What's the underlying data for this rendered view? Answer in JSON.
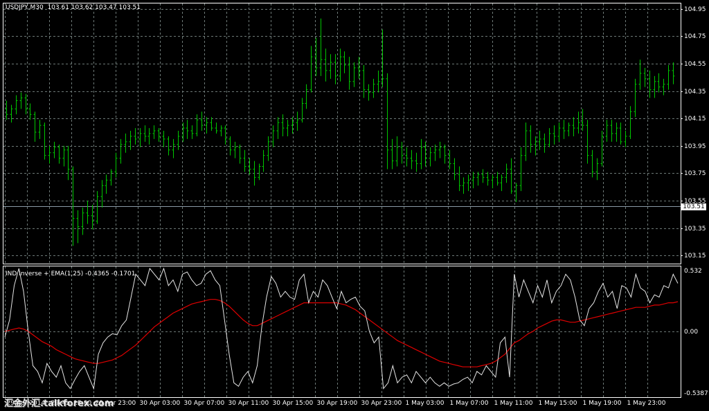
{
  "chart_data": [
    {
      "type": "bar",
      "subtype": "ohlc",
      "title": "USDJPY,M30",
      "ohlc_header": "103.61 103.62 103.47 103.51",
      "last_price": "103.51",
      "colors": {
        "background": "#000000",
        "bars": "#00c800",
        "grid": "#6e7a78",
        "axis": "#ffffff",
        "price_line": "#8a9aa6"
      },
      "ylim": [
        103.09,
        104.99
      ],
      "y_ticks": [
        "104.95",
        "104.75",
        "104.55",
        "104.35",
        "104.15",
        "103.95",
        "103.75",
        "103.55",
        "103.35",
        "103.15"
      ],
      "grid": true,
      "x_ticks": [
        "29 Apr 2014",
        "29 Apr 15:00",
        "29 Apr 23:00",
        "30 Apr 03:00",
        "30 Apr 07:00",
        "30 Apr 11:00",
        "30 Apr 15:00",
        "30 Apr 19:00",
        "30 Apr 23:00",
        "1 May 03:00",
        "1 May 07:00",
        "1 May 11:00",
        "1 May 15:00",
        "1 May 19:00",
        "1 May 23:00"
      ],
      "bars": [
        [
          104.22,
          104.28,
          104.14,
          104.18
        ],
        [
          104.18,
          104.25,
          104.12,
          104.22
        ],
        [
          104.22,
          104.32,
          104.18,
          104.28
        ],
        [
          104.28,
          104.34,
          104.22,
          104.3
        ],
        [
          104.3,
          104.33,
          104.18,
          104.22
        ],
        [
          104.22,
          104.26,
          104.14,
          104.18
        ],
        [
          104.18,
          104.2,
          103.98,
          104.05
        ],
        [
          104.05,
          104.14,
          104.0,
          104.1
        ],
        [
          104.1,
          104.12,
          103.85,
          103.88
        ],
        [
          103.88,
          103.95,
          103.82,
          103.9
        ],
        [
          103.9,
          103.98,
          103.86,
          103.94
        ],
        [
          103.94,
          103.96,
          103.82,
          103.86
        ],
        [
          103.86,
          103.95,
          103.8,
          103.92
        ],
        [
          103.92,
          103.95,
          103.7,
          103.78
        ],
        [
          103.78,
          103.8,
          103.22,
          103.42
        ],
        [
          103.42,
          103.48,
          103.24,
          103.36
        ],
        [
          103.36,
          103.5,
          103.3,
          103.46
        ],
        [
          103.46,
          103.55,
          103.38,
          103.44
        ],
        [
          103.44,
          103.52,
          103.34,
          103.4
        ],
        [
          103.4,
          103.62,
          103.38,
          103.58
        ],
        [
          103.58,
          103.7,
          103.5,
          103.66
        ],
        [
          103.66,
          103.74,
          103.6,
          103.7
        ],
        [
          103.7,
          103.78,
          103.66,
          103.76
        ],
        [
          103.76,
          103.9,
          103.72,
          103.86
        ],
        [
          103.86,
          104.0,
          103.82,
          103.96
        ],
        [
          103.96,
          104.04,
          103.9,
          103.98
        ],
        [
          103.98,
          104.06,
          103.92,
          104.02
        ],
        [
          104.02,
          104.08,
          103.96,
          104.0
        ],
        [
          104.0,
          104.08,
          103.94,
          104.04
        ],
        [
          104.04,
          104.1,
          103.98,
          104.02
        ],
        [
          104.02,
          104.08,
          103.96,
          104.04
        ],
        [
          104.04,
          104.1,
          104.0,
          104.06
        ],
        [
          104.06,
          104.08,
          103.98,
          104.02
        ],
        [
          104.02,
          104.06,
          103.94,
          104.0
        ],
        [
          104.0,
          104.02,
          103.88,
          103.92
        ],
        [
          103.92,
          104.0,
          103.86,
          103.96
        ],
        [
          103.96,
          104.06,
          103.92,
          104.02
        ],
        [
          104.02,
          104.12,
          103.98,
          104.08
        ],
        [
          104.08,
          104.14,
          104.0,
          104.06
        ],
        [
          104.06,
          104.1,
          104.0,
          104.04
        ],
        [
          104.04,
          104.18,
          104.02,
          104.14
        ],
        [
          104.14,
          104.2,
          104.06,
          104.1
        ],
        [
          104.1,
          104.16,
          104.04,
          104.12
        ],
        [
          104.12,
          104.16,
          104.06,
          104.08
        ],
        [
          104.08,
          104.12,
          104.04,
          104.06
        ],
        [
          104.06,
          104.1,
          104.02,
          104.08
        ],
        [
          104.08,
          104.1,
          103.96,
          104.0
        ],
        [
          104.0,
          104.02,
          103.88,
          103.92
        ],
        [
          103.92,
          103.98,
          103.86,
          103.94
        ],
        [
          103.94,
          103.96,
          103.82,
          103.86
        ],
        [
          103.86,
          103.92,
          103.76,
          103.8
        ],
        [
          103.8,
          103.86,
          103.74,
          103.78
        ],
        [
          103.78,
          103.84,
          103.66,
          103.72
        ],
        [
          103.72,
          103.82,
          103.7,
          103.8
        ],
        [
          103.8,
          103.92,
          103.76,
          103.88
        ],
        [
          103.88,
          104.02,
          103.84,
          103.98
        ],
        [
          103.98,
          104.1,
          103.94,
          104.06
        ],
        [
          104.06,
          104.16,
          104.0,
          104.12
        ],
        [
          104.12,
          104.18,
          104.02,
          104.08
        ],
        [
          104.08,
          104.14,
          104.02,
          104.1
        ],
        [
          104.1,
          104.16,
          104.04,
          104.12
        ],
        [
          104.12,
          104.2,
          104.06,
          104.14
        ],
        [
          104.14,
          104.3,
          104.12,
          104.26
        ],
        [
          104.26,
          104.4,
          104.22,
          104.36
        ],
        [
          104.36,
          104.68,
          104.34,
          104.6
        ],
        [
          104.6,
          104.74,
          104.46,
          104.52
        ],
        [
          104.52,
          104.88,
          104.46,
          104.58
        ],
        [
          104.58,
          104.66,
          104.42,
          104.5
        ],
        [
          104.5,
          104.62,
          104.44,
          104.56
        ],
        [
          104.56,
          104.62,
          104.4,
          104.46
        ],
        [
          104.46,
          104.66,
          104.42,
          104.6
        ],
        [
          104.6,
          104.64,
          104.48,
          104.54
        ],
        [
          104.54,
          104.6,
          104.36,
          104.42
        ],
        [
          104.42,
          104.56,
          104.38,
          104.52
        ],
        [
          104.52,
          104.6,
          104.44,
          104.5
        ],
        [
          104.5,
          104.54,
          104.3,
          104.36
        ],
        [
          104.36,
          104.4,
          104.28,
          104.34
        ],
        [
          104.34,
          104.44,
          104.3,
          104.4
        ],
        [
          104.4,
          104.5,
          104.34,
          104.42
        ],
        [
          104.42,
          104.8,
          104.38,
          104.44
        ],
        [
          104.44,
          104.48,
          103.78,
          103.92
        ],
        [
          103.92,
          104.0,
          103.78,
          103.84
        ],
        [
          103.84,
          104.02,
          103.8,
          103.94
        ],
        [
          103.94,
          103.98,
          103.82,
          103.88
        ],
        [
          103.88,
          103.94,
          103.8,
          103.86
        ],
        [
          103.86,
          103.92,
          103.78,
          103.84
        ],
        [
          103.84,
          103.9,
          103.76,
          103.82
        ],
        [
          103.82,
          104.0,
          103.78,
          103.94
        ],
        [
          103.94,
          103.98,
          103.8,
          103.86
        ],
        [
          103.86,
          103.94,
          103.8,
          103.9
        ],
        [
          103.9,
          103.96,
          103.84,
          103.92
        ],
        [
          103.92,
          103.98,
          103.86,
          103.94
        ],
        [
          103.94,
          103.96,
          103.82,
          103.88
        ],
        [
          103.88,
          103.92,
          103.78,
          103.82
        ],
        [
          103.82,
          103.86,
          103.7,
          103.74
        ],
        [
          103.74,
          103.8,
          103.62,
          103.66
        ],
        [
          103.66,
          103.72,
          103.6,
          103.68
        ],
        [
          103.68,
          103.74,
          103.62,
          103.7
        ],
        [
          103.7,
          103.76,
          103.64,
          103.72
        ],
        [
          103.72,
          103.76,
          103.66,
          103.74
        ],
        [
          103.74,
          103.78,
          103.68,
          103.72
        ],
        [
          103.72,
          103.76,
          103.66,
          103.7
        ],
        [
          103.7,
          103.74,
          103.64,
          103.72
        ],
        [
          103.72,
          103.76,
          103.66,
          103.68
        ],
        [
          103.68,
          103.74,
          103.62,
          103.72
        ],
        [
          103.72,
          103.82,
          103.68,
          103.78
        ],
        [
          103.78,
          103.86,
          103.6,
          103.62
        ],
        [
          103.62,
          103.68,
          103.54,
          103.66
        ],
        [
          103.66,
          103.94,
          103.62,
          103.88
        ],
        [
          103.88,
          104.12,
          103.84,
          104.06
        ],
        [
          104.06,
          104.1,
          103.9,
          103.96
        ],
        [
          103.96,
          104.02,
          103.88,
          103.98
        ],
        [
          103.98,
          104.06,
          103.92,
          104.0
        ],
        [
          104.0,
          104.04,
          103.9,
          103.96
        ],
        [
          103.96,
          104.08,
          103.94,
          104.04
        ],
        [
          104.04,
          104.1,
          103.96,
          104.02
        ],
        [
          104.02,
          104.12,
          103.98,
          104.08
        ],
        [
          104.08,
          104.14,
          104.0,
          104.06
        ],
        [
          104.06,
          104.12,
          104.02,
          104.1
        ],
        [
          104.1,
          104.16,
          104.02,
          104.08
        ],
        [
          104.08,
          104.2,
          104.04,
          104.12
        ],
        [
          104.12,
          104.22,
          104.06,
          104.1
        ],
        [
          104.1,
          104.14,
          103.82,
          103.88
        ],
        [
          103.88,
          103.92,
          103.72,
          103.76
        ],
        [
          103.76,
          103.86,
          103.7,
          103.82
        ],
        [
          103.82,
          104.06,
          103.8,
          104.02
        ],
        [
          104.02,
          104.14,
          103.98,
          104.1
        ],
        [
          104.1,
          104.14,
          103.98,
          104.04
        ],
        [
          104.04,
          104.12,
          103.98,
          104.08
        ],
        [
          104.08,
          104.12,
          103.96,
          103.98
        ],
        [
          103.98,
          104.06,
          103.94,
          104.02
        ],
        [
          104.02,
          104.24,
          104.0,
          104.2
        ],
        [
          104.2,
          104.44,
          104.16,
          104.4
        ],
        [
          104.4,
          104.58,
          104.36,
          104.48
        ],
        [
          104.48,
          104.52,
          104.38,
          104.44
        ],
        [
          104.44,
          104.5,
          104.3,
          104.36
        ],
        [
          104.36,
          104.46,
          104.3,
          104.42
        ],
        [
          104.42,
          104.48,
          104.34,
          104.38
        ],
        [
          104.38,
          104.44,
          104.32,
          104.4
        ],
        [
          104.4,
          104.54,
          104.36,
          104.5
        ],
        [
          104.5,
          104.56,
          104.4,
          104.46
        ]
      ]
    },
    {
      "type": "line",
      "title": "IND Inverse + EMA(1,25) -0.4365 -0.1701",
      "colors": {
        "indicator": "#e6e6e6",
        "ema": "#e00000"
      },
      "ylim": [
        -0.5387,
        0.532
      ],
      "y_ticks": [
        "0.532",
        "0.00",
        "-0.5387"
      ],
      "grid": true,
      "indicator": [
        -0.05,
        0.1,
        0.4,
        0.55,
        0.35,
        0.0,
        -0.3,
        -0.35,
        -0.45,
        -0.28,
        -0.35,
        -0.4,
        -0.3,
        -0.45,
        -0.5,
        -0.42,
        -0.35,
        -0.3,
        -0.4,
        -0.5,
        -0.2,
        -0.1,
        -0.05,
        -0.02,
        -0.03,
        0.05,
        0.1,
        0.3,
        0.5,
        0.45,
        0.4,
        0.55,
        0.5,
        0.45,
        0.55,
        0.4,
        0.45,
        0.35,
        0.5,
        0.52,
        0.45,
        0.4,
        0.42,
        0.5,
        0.53,
        0.45,
        0.4,
        0.1,
        -0.2,
        -0.45,
        -0.48,
        -0.4,
        -0.35,
        -0.45,
        -0.3,
        0.05,
        0.3,
        0.48,
        0.42,
        0.3,
        0.35,
        0.3,
        0.28,
        0.45,
        0.5,
        0.25,
        0.35,
        0.3,
        0.45,
        0.4,
        0.3,
        0.2,
        0.35,
        0.25,
        0.28,
        0.3,
        0.22,
        0.18,
        0.0,
        -0.1,
        -0.05,
        -0.5,
        -0.45,
        -0.3,
        -0.45,
        -0.4,
        -0.38,
        -0.45,
        -0.35,
        -0.4,
        -0.45,
        -0.4,
        -0.45,
        -0.48,
        -0.45,
        -0.48,
        -0.46,
        -0.45,
        -0.42,
        -0.4,
        -0.45,
        -0.35,
        -0.38,
        -0.3,
        -0.35,
        -0.4,
        -0.1,
        -0.05,
        -0.4,
        0.5,
        0.3,
        0.45,
        0.35,
        0.25,
        0.4,
        0.3,
        0.45,
        0.25,
        0.35,
        0.4,
        0.5,
        0.45,
        0.3,
        0.1,
        0.05,
        0.2,
        0.25,
        0.35,
        0.42,
        0.3,
        0.35,
        0.2,
        0.4,
        0.38,
        0.3,
        0.5,
        0.38,
        0.35,
        0.25,
        0.32,
        0.3,
        0.4,
        0.38,
        0.5,
        0.42
      ],
      "ema": [
        0.0,
        0.01,
        0.02,
        0.03,
        0.02,
        0.0,
        -0.03,
        -0.06,
        -0.09,
        -0.11,
        -0.13,
        -0.16,
        -0.18,
        -0.2,
        -0.22,
        -0.24,
        -0.25,
        -0.26,
        -0.27,
        -0.28,
        -0.28,
        -0.27,
        -0.26,
        -0.25,
        -0.23,
        -0.21,
        -0.18,
        -0.15,
        -0.12,
        -0.08,
        -0.04,
        0.0,
        0.04,
        0.07,
        0.1,
        0.13,
        0.16,
        0.18,
        0.2,
        0.22,
        0.24,
        0.25,
        0.26,
        0.27,
        0.28,
        0.28,
        0.27,
        0.25,
        0.22,
        0.18,
        0.14,
        0.1,
        0.07,
        0.05,
        0.05,
        0.07,
        0.09,
        0.11,
        0.13,
        0.15,
        0.17,
        0.19,
        0.21,
        0.23,
        0.25,
        0.25,
        0.25,
        0.25,
        0.25,
        0.25,
        0.25,
        0.25,
        0.24,
        0.23,
        0.21,
        0.19,
        0.16,
        0.13,
        0.1,
        0.07,
        0.04,
        0.01,
        -0.02,
        -0.05,
        -0.08,
        -0.1,
        -0.12,
        -0.14,
        -0.16,
        -0.18,
        -0.2,
        -0.22,
        -0.24,
        -0.26,
        -0.27,
        -0.28,
        -0.29,
        -0.3,
        -0.31,
        -0.31,
        -0.31,
        -0.31,
        -0.3,
        -0.29,
        -0.28,
        -0.26,
        -0.23,
        -0.2,
        -0.15,
        -0.1,
        -0.08,
        -0.05,
        -0.02,
        0.0,
        0.03,
        0.05,
        0.07,
        0.09,
        0.1,
        0.1,
        0.09,
        0.08,
        0.08,
        0.09,
        0.1,
        0.11,
        0.12,
        0.13,
        0.14,
        0.15,
        0.16,
        0.17,
        0.18,
        0.19,
        0.2,
        0.21,
        0.21,
        0.21,
        0.22,
        0.23,
        0.23,
        0.24,
        0.25,
        0.25,
        0.26
      ]
    }
  ]
}
